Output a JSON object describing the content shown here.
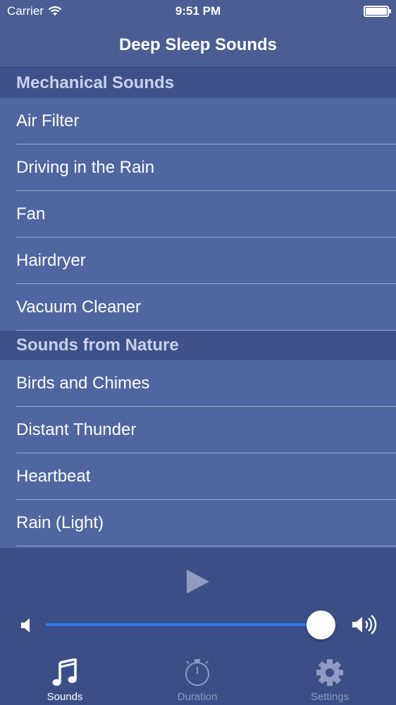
{
  "status_bar": {
    "carrier": "Carrier",
    "time": "9:51 PM"
  },
  "nav": {
    "title": "Deep Sleep Sounds"
  },
  "sections": [
    {
      "title": "Mechanical Sounds",
      "items": [
        "Air Filter",
        "Driving in the Rain",
        "Fan",
        "Hairdryer",
        "Vacuum Cleaner"
      ]
    },
    {
      "title": "Sounds from Nature",
      "items": [
        "Birds and Chimes",
        "Distant Thunder",
        "Heartbeat",
        "Rain (Light)"
      ]
    }
  ],
  "player": {
    "volume": 0.94,
    "play_icon": "play-icon",
    "volume_low_icon": "volume-low-icon",
    "volume_high_icon": "volume-high-icon"
  },
  "tabs": [
    {
      "label": "Sounds",
      "icon": "music-note-icon",
      "active": true
    },
    {
      "label": "Duration",
      "icon": "stopwatch-icon",
      "active": false
    },
    {
      "label": "Settings",
      "icon": "gear-icon",
      "active": false
    }
  ],
  "colors": {
    "background": "#3b4f86",
    "list_row": "#5066a1",
    "section_header": "#3e5189",
    "slider_accent": "#2d7bf6",
    "inactive_tab": "#8f9bc1"
  }
}
